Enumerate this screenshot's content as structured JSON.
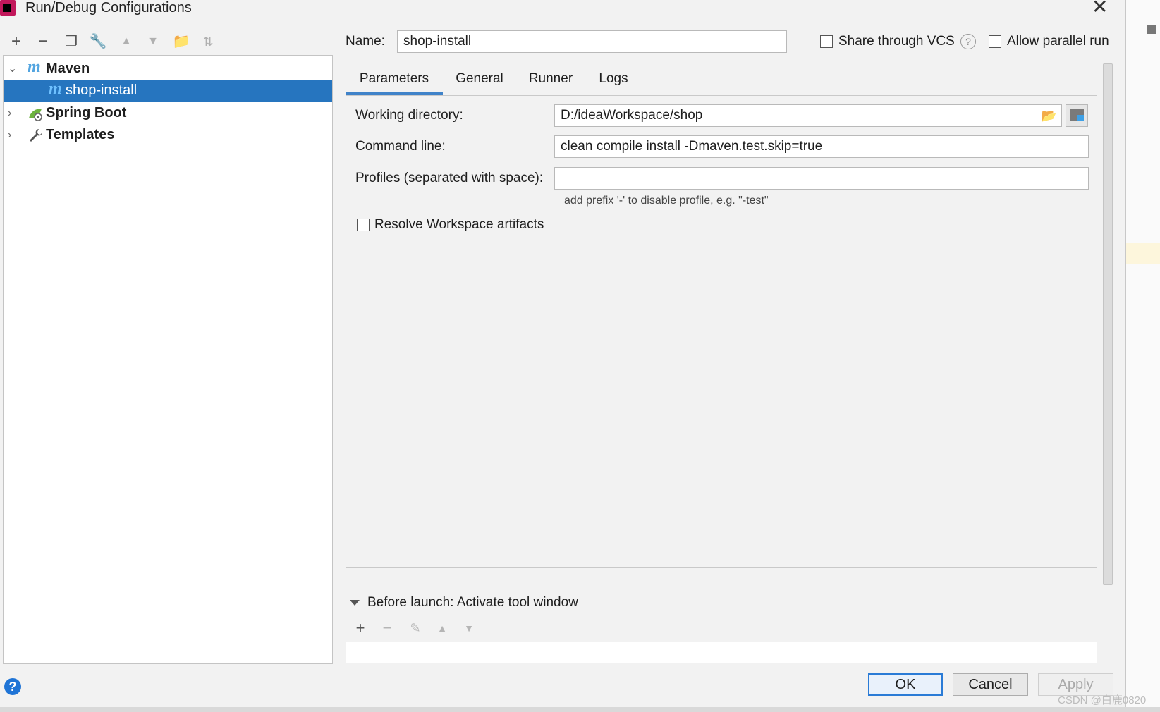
{
  "window": {
    "title": "Run/Debug Configurations"
  },
  "tree": {
    "items": [
      {
        "label": "Maven",
        "icon": "maven-icon",
        "glyph": "m"
      },
      {
        "label": "shop-install",
        "icon": "maven-config-icon",
        "glyph": "m"
      },
      {
        "label": "Spring Boot",
        "icon": "spring-boot-icon"
      },
      {
        "label": "Templates",
        "icon": "wrench-icon"
      }
    ]
  },
  "header": {
    "name_label": "Name:",
    "name_value": "shop-install",
    "share_vcs_label": "Share through VCS",
    "share_vcs_checked": false,
    "parallel_label": "Allow parallel run",
    "parallel_checked": false
  },
  "tabs": [
    {
      "label": "Parameters",
      "active": true
    },
    {
      "label": "General"
    },
    {
      "label": "Runner"
    },
    {
      "label": "Logs"
    }
  ],
  "params": {
    "workdir_label": "Working directory:",
    "workdir_value": "D:/ideaWorkspace/shop",
    "cmd_label": "Command line:",
    "cmd_value": "clean compile install -Dmaven.test.skip=true",
    "profiles_label": "Profiles (separated with space):",
    "profiles_value": "",
    "profiles_hint": "add prefix '-' to disable profile, e.g. \"-test\"",
    "resolve_label": "Resolve Workspace artifacts",
    "resolve_checked": false
  },
  "before_launch": {
    "title": "Before launch: Activate tool window"
  },
  "buttons": {
    "ok": "OK",
    "cancel": "Cancel",
    "apply": "Apply"
  },
  "watermark": "CSDN @白鹿0820",
  "colors": {
    "selection": "#2675bf",
    "accent": "#4083c9",
    "help": "#1f74d6"
  }
}
